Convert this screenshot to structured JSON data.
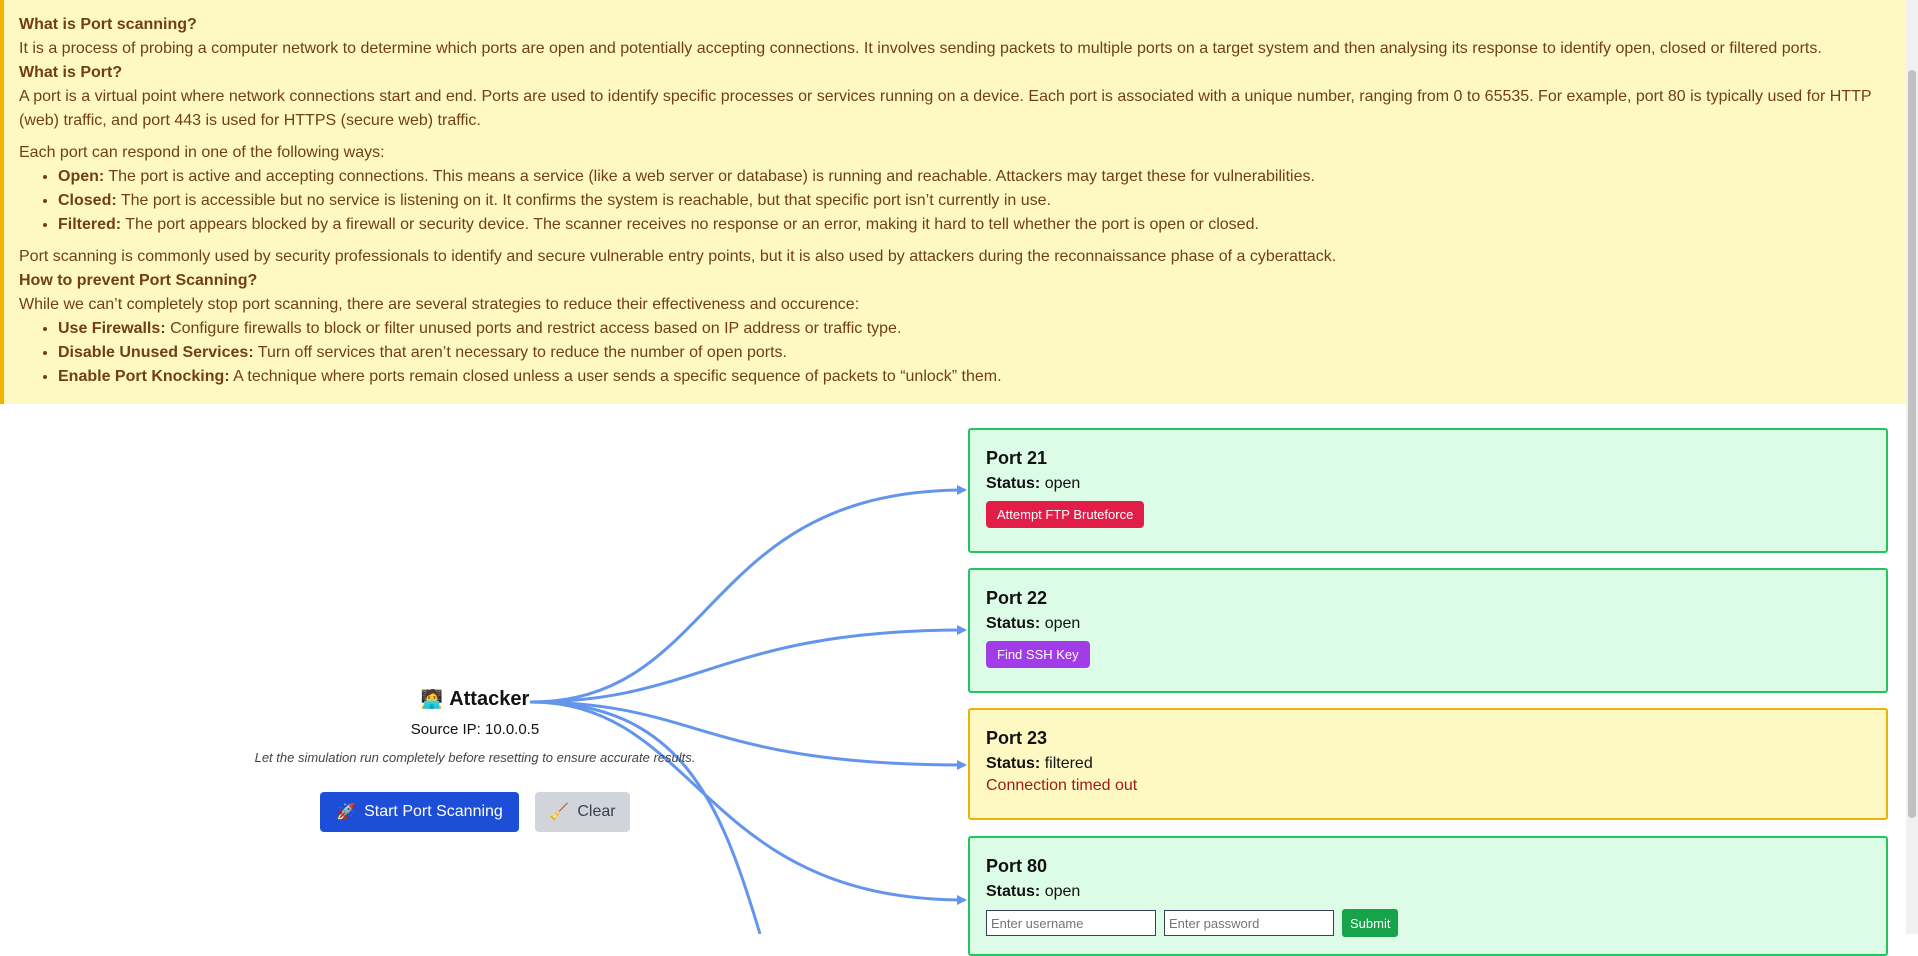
{
  "info": {
    "q1": "What is Port scanning?",
    "a1": "It is a process of probing a computer network to determine which ports are open and potentially accepting connections. It involves sending packets to multiple ports on a target system and then analysing its response to identify open, closed or filtered ports.",
    "q2": "What is Port?",
    "a2": "A port is a virtual point where network connections start and end. Ports are used to identify specific processes or services running on a device. Each port is associated with a unique number, ranging from 0 to 65535. For example, port 80 is typically used for HTTP (web) traffic, and port 443 is used for HTTPS (secure web) traffic.",
    "respond_intro": "Each port can respond in one of the following ways:",
    "states": [
      {
        "term": "Open:",
        "desc": "The port is active and accepting connections. This means a service (like a web server or database) is running and reachable. Attackers may target these for vulnerabilities."
      },
      {
        "term": "Closed:",
        "desc": "The port is accessible but no service is listening on it. It confirms the system is reachable, but that specific port isn’t currently in use."
      },
      {
        "term": "Filtered:",
        "desc": "The port appears blocked by a firewall or security device. The scanner receives no response or an error, making it hard to tell whether the port is open or closed."
      }
    ],
    "usage": "Port scanning is commonly used by security professionals to identify and secure vulnerable entry points, but it is also used by attackers during the reconnaissance phase of a cyberattack.",
    "q3": "How to prevent Port Scanning?",
    "a3": "While we can’t completely stop port scanning, there are several strategies to reduce their effectiveness and occurence:",
    "strategies": [
      {
        "term": "Use Firewalls:",
        "desc": "Configure firewalls to block or filter unused ports and restrict access based on IP address or traffic type."
      },
      {
        "term": "Disable Unused Services:",
        "desc": "Turn off services that aren’t necessary to reduce the number of open ports."
      },
      {
        "term": "Enable Port Knocking:",
        "desc": "A technique where ports remain closed unless a user sends a specific sequence of packets to “unlock” them."
      }
    ]
  },
  "attacker": {
    "icon": "🧑‍💻",
    "title": "Attacker",
    "source_ip": "Source IP: 10.0.0.5",
    "note": "Let the simulation run completely before resetting to ensure accurate results.",
    "start_icon": "🚀",
    "start_label": "Start Port Scanning",
    "clear_icon": "🧹",
    "clear_label": "Clear"
  },
  "status_label": "Status:",
  "ports": [
    {
      "name": "Port 21",
      "status": "open",
      "action": "Attempt FTP Bruteforce"
    },
    {
      "name": "Port 22",
      "status": "open",
      "action": "Find SSH Key"
    },
    {
      "name": "Port 23",
      "status": "filtered",
      "message": "Connection timed out"
    },
    {
      "name": "Port 80",
      "status": "open",
      "username_placeholder": "Enter username",
      "password_placeholder": "Enter password",
      "submit_label": "Submit"
    }
  ],
  "colors": {
    "arrow": "#6495ed",
    "open_bg": "#dcfce7",
    "filtered_bg": "#fef9c3"
  }
}
